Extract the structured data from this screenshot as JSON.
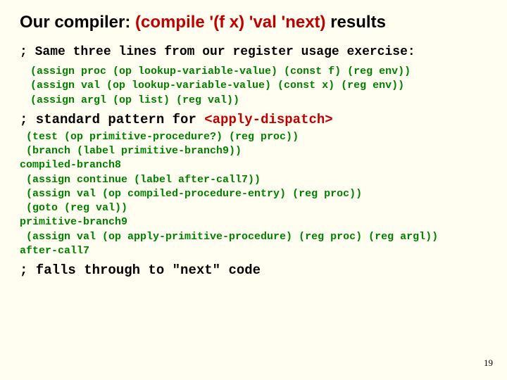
{
  "title_pre": "Our compiler: ",
  "title_mid": "(compile '(f x) 'val 'next)",
  "title_post": " results",
  "line1": "; Same three lines from our register usage exercise:",
  "green1": " (assign proc (op lookup-variable-value) (const f) (reg env))\n (assign val (op lookup-variable-value) (const x) (reg env))\n (assign argl (op list) (reg val))",
  "comment1_pre": " ; standard pattern for ",
  "comment1_red": "<apply-dispatch>",
  "green2": " (test (op primitive-procedure?) (reg proc))\n (branch (label primitive-branch9))\ncompiled-branch8\n (assign continue (label after-call7))\n (assign val (op compiled-procedure-entry) (reg proc))\n (goto (reg val))\nprimitive-branch9\n (assign val (op apply-primitive-procedure) (reg proc) (reg argl))\nafter-call7",
  "comment2": " ; falls through to \"next\" code",
  "pagenum": "19"
}
